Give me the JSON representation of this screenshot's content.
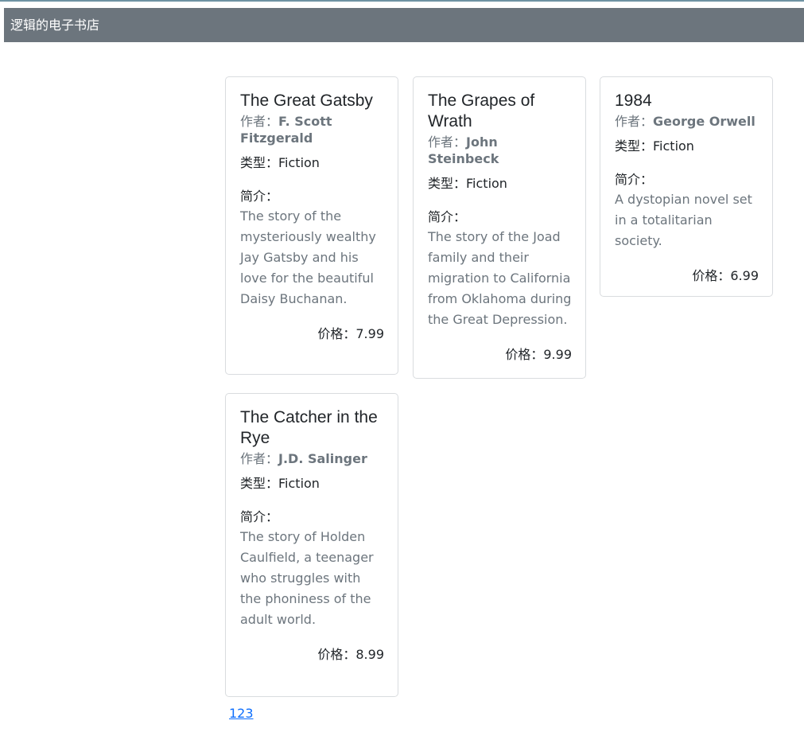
{
  "navbar": {
    "brand": "逻辑的电子书店"
  },
  "labels": {
    "author_prefix": "作者：",
    "genre_prefix": "类型：",
    "intro_label": "简介：",
    "price_prefix": "价格："
  },
  "books": [
    {
      "title": "The Great Gatsby",
      "author": "F. Scott Fitzgerald",
      "genre": "Fiction",
      "description": "The story of the mysteriously wealthy Jay Gatsby and his love for the beautiful Daisy Buchanan.",
      "price": "7.99"
    },
    {
      "title": "The Grapes of Wrath",
      "author": "John Steinbeck",
      "genre": "Fiction",
      "description": "The story of the Joad family and their migration to California from Oklahoma during the Great Depression.",
      "price": "9.99"
    },
    {
      "title": "1984",
      "author": "George Orwell",
      "genre": "Fiction",
      "description": "A dystopian novel set in a totalitarian society.",
      "price": "6.99"
    },
    {
      "title": "The Catcher in the Rye",
      "author": "J.D. Salinger",
      "genre": "Fiction",
      "description": "The story of Holden Caulfield, a teenager who struggles with the phoniness of the adult world.",
      "price": "8.99"
    }
  ],
  "footer": {
    "link_text": "123"
  }
}
